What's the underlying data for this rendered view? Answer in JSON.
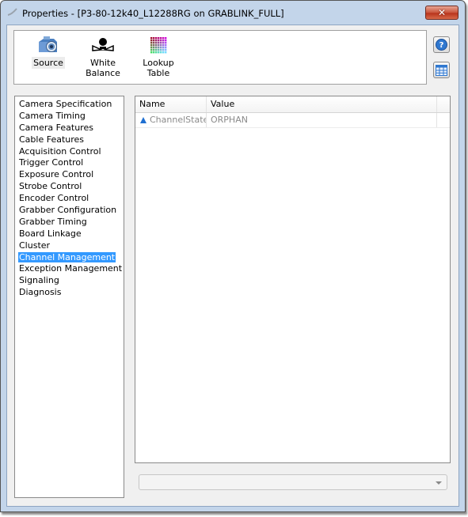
{
  "window": {
    "title": "Properties - [P3-80-12k40_L12288RG on GRABLINK_FULL]",
    "close_label": "✕"
  },
  "toolbar": {
    "tools": [
      {
        "label": "Source",
        "icon": "camera-icon"
      },
      {
        "label": "White Balance",
        "icon": "white-balance-icon"
      },
      {
        "label": "Lookup Table",
        "icon": "lookup-table-icon"
      }
    ],
    "side_buttons": [
      {
        "name": "help",
        "icon": "help-icon"
      },
      {
        "name": "table-view",
        "icon": "table-icon"
      }
    ]
  },
  "categories": {
    "items": [
      {
        "label": "Camera Specification"
      },
      {
        "label": "Camera Timing"
      },
      {
        "label": "Camera Features"
      },
      {
        "label": "Cable Features"
      },
      {
        "label": "Acquisition Control"
      },
      {
        "label": "Trigger Control"
      },
      {
        "label": "Exposure Control"
      },
      {
        "label": "Strobe Control"
      },
      {
        "label": "Encoder Control"
      },
      {
        "label": "Grabber Configuration"
      },
      {
        "label": "Grabber Timing"
      },
      {
        "label": "Board Linkage"
      },
      {
        "label": "Cluster"
      },
      {
        "label": "Channel Management",
        "selected": true
      },
      {
        "label": "Exception Management"
      },
      {
        "label": "Signaling"
      },
      {
        "label": "Diagnosis"
      }
    ],
    "selected_index": 13
  },
  "properties": {
    "columns": [
      "Name",
      "Value"
    ],
    "rows": [
      {
        "name": "ChannelState",
        "value": "ORPHAN",
        "icon": "triangle-icon"
      }
    ]
  },
  "combo": {
    "value": ""
  },
  "colors": {
    "selection": "#3399ff",
    "row_icon": "#1f6fd1",
    "close_button": "#c9553b"
  }
}
